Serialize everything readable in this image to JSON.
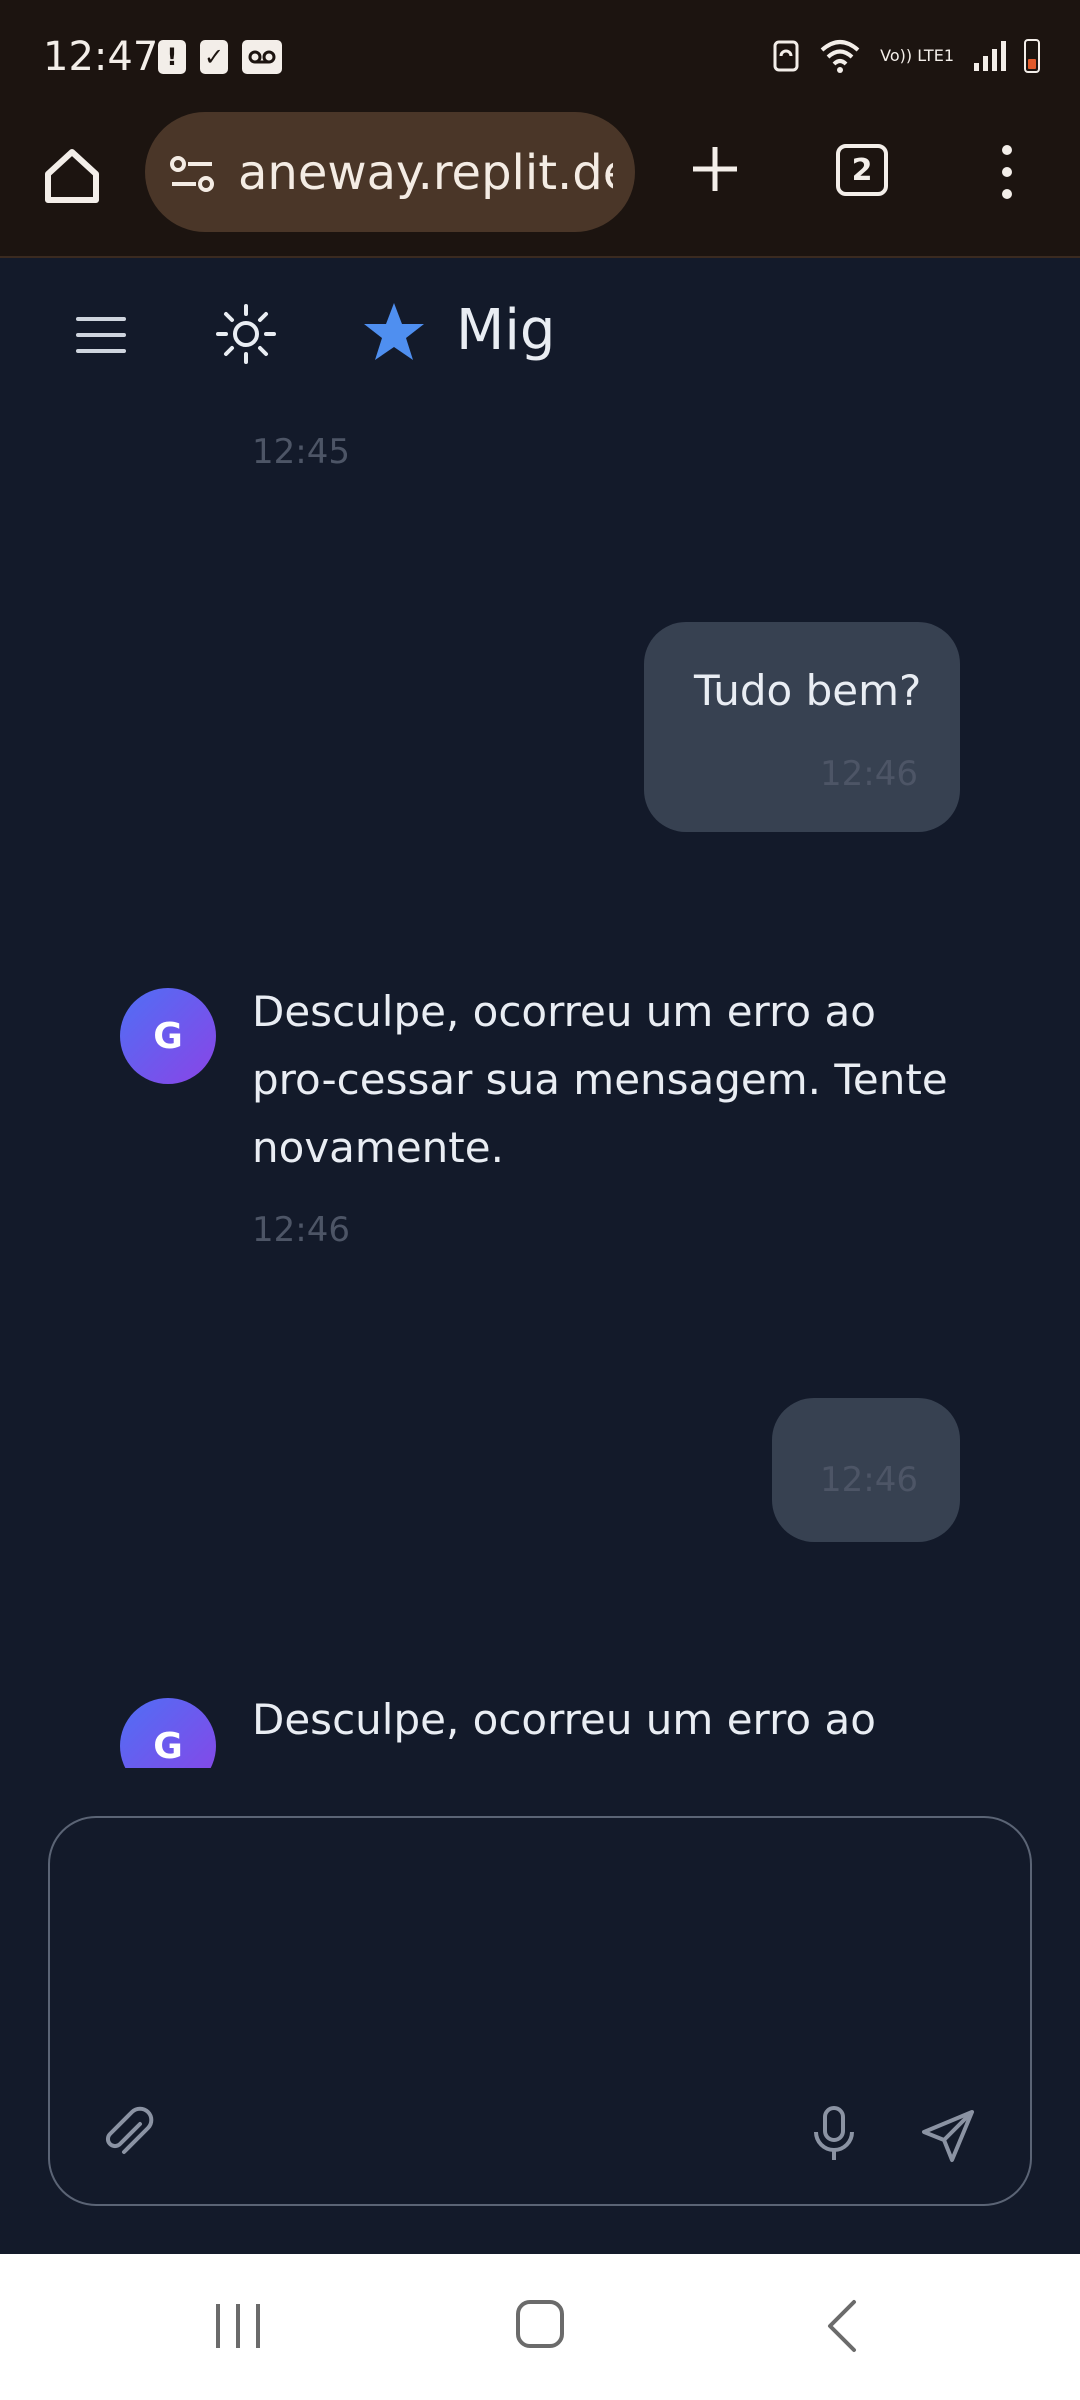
{
  "status_bar": {
    "time": "12:47",
    "network": "Vo)) LTE1"
  },
  "browser": {
    "url": "aneway.replit.dev",
    "tab_count": "2"
  },
  "app": {
    "title": "Mig"
  },
  "messages": [
    {
      "role": "assistant",
      "text": "",
      "time": "12:45"
    },
    {
      "role": "user",
      "text": "Tudo bem?",
      "time": "12:46"
    },
    {
      "role": "assistant",
      "avatar": "G",
      "text": "Desculpe, ocorreu um erro ao pro-cessar sua mensagem. Tente novamente.",
      "time": "12:46"
    },
    {
      "role": "user",
      "text": "",
      "time": "12:46"
    },
    {
      "role": "assistant",
      "avatar": "G",
      "text": "Desculpe, ocorreu um erro ao pro-",
      "time": ""
    }
  ],
  "composer": {
    "value": "",
    "placeholder": ""
  },
  "icons": {
    "home": "home-icon",
    "site_settings": "site-settings-icon",
    "new_tab": "plus-icon",
    "menu": "more-vert-icon",
    "hamburger": "menu-icon",
    "theme": "sun-icon",
    "logo": "star-icon",
    "attach": "paperclip-icon",
    "mic": "microphone-icon",
    "send": "send-icon"
  },
  "colors": {
    "background": "#131a2a",
    "user_bubble": "#374151",
    "accent_star": "#4f8ff0",
    "avatar_gradient_start": "#4f6ff5",
    "avatar_gradient_end": "#8a44e6"
  }
}
